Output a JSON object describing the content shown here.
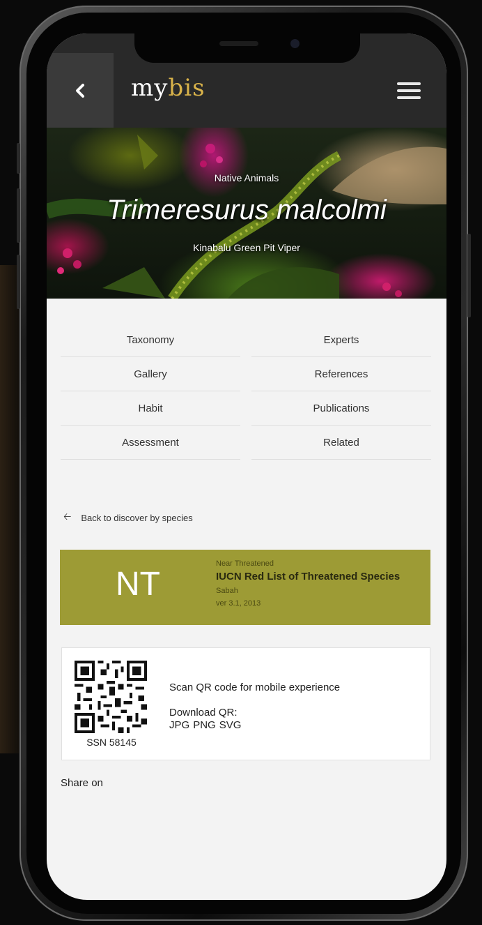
{
  "header": {
    "logo_part1": "my",
    "logo_part2": "bis",
    "accent_color": "#d8b24a"
  },
  "hero": {
    "category": "Native Animals",
    "scientific_name": "Trimeresurus malcolmi",
    "common_name": "Kinabalu Green Pit Viper"
  },
  "nav": {
    "items": [
      {
        "label": "Taxonomy"
      },
      {
        "label": "Experts"
      },
      {
        "label": "Gallery"
      },
      {
        "label": "References"
      },
      {
        "label": "Habit"
      },
      {
        "label": "Publications"
      },
      {
        "label": "Assessment"
      },
      {
        "label": "Related"
      }
    ]
  },
  "back_link": {
    "label": "Back to discover by species"
  },
  "status": {
    "code": "NT",
    "label": "Near Threatened",
    "title": "IUCN Red List of Threatened Species",
    "region": "Sabah",
    "version": "ver 3.1, 2013",
    "color": "#9d9b35"
  },
  "qr": {
    "ssn": "SSN 58145",
    "scan_text": "Scan QR code for mobile experience",
    "download_label": "Download QR:",
    "formats": [
      "JPG",
      "PNG",
      "SVG"
    ]
  },
  "share": {
    "label": "Share on"
  }
}
